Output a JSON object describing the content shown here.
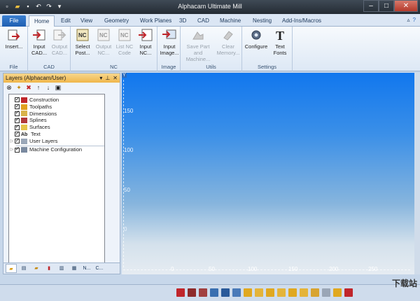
{
  "window": {
    "title": "Alphacam Ultimate Mill",
    "qat": [
      "new-icon",
      "open-icon",
      "save-icon",
      "undo-icon",
      "redo-icon",
      "dropdown-icon"
    ]
  },
  "tabs": [
    {
      "label": "File"
    },
    {
      "label": "Home",
      "active": true
    },
    {
      "label": "Edit"
    },
    {
      "label": "View"
    },
    {
      "label": "Geometry"
    },
    {
      "label": "Work Planes"
    },
    {
      "label": "3D"
    },
    {
      "label": "CAD"
    },
    {
      "label": "Machine"
    },
    {
      "label": "Nesting"
    },
    {
      "label": "Add-Ins/Macros"
    }
  ],
  "ribbon": {
    "groups": {
      "file": {
        "label": "File",
        "buttons": [
          {
            "label": "Insert..."
          }
        ]
      },
      "cad": {
        "label": "CAD",
        "buttons": [
          {
            "label": "Input CAD..."
          },
          {
            "label": "Output CAD..."
          }
        ]
      },
      "nc": {
        "label": "NC",
        "buttons": [
          {
            "label": "Select Post..."
          },
          {
            "label": "Output NC..."
          },
          {
            "label": "List NC Code"
          },
          {
            "label": "Input NC..."
          }
        ]
      },
      "image": {
        "label": "Image",
        "buttons": [
          {
            "label": "Input Image..."
          }
        ]
      },
      "utils": {
        "label": "Utils",
        "buttons": [
          {
            "label": "Save Part and Machine..."
          },
          {
            "label": "Clear Memory..."
          }
        ]
      },
      "settings": {
        "label": "Settings",
        "buttons": [
          {
            "label": "Configure"
          },
          {
            "label": "Text Fonts"
          }
        ]
      }
    }
  },
  "layers": {
    "title": "Layers (Alphacam/User)",
    "items": [
      {
        "label": "Construction"
      },
      {
        "label": "Toolpaths"
      },
      {
        "label": "Dimensions"
      },
      {
        "label": "Splines"
      },
      {
        "label": "Surfaces"
      },
      {
        "label": "Text"
      },
      {
        "label": "User Layers"
      },
      {
        "label": "Machine Configuration"
      }
    ],
    "bottom_tabs": [
      "",
      "",
      "",
      "",
      "",
      "",
      "N...",
      "C..."
    ]
  },
  "canvas": {
    "y_axis_tag": "Y",
    "y_labels": [
      "150",
      "100",
      "50",
      "0"
    ],
    "x_labels": [
      "0",
      "50",
      "100",
      "150",
      "200",
      "250"
    ]
  },
  "watermark": "下载站"
}
